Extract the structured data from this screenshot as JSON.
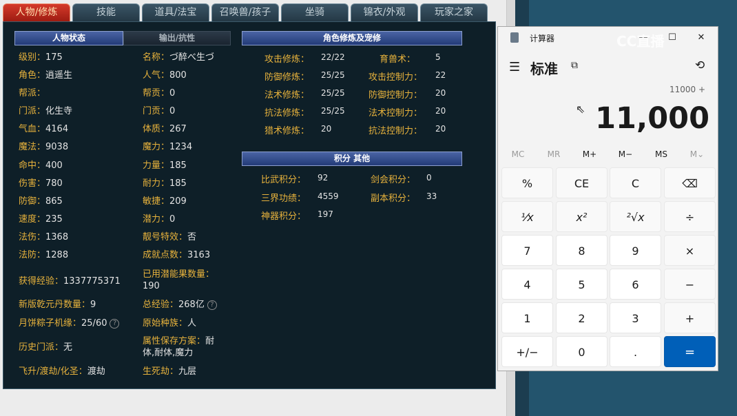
{
  "tabs": [
    "人物/修炼",
    "技能",
    "道具/法宝",
    "召唤兽/孩子",
    "坐骑",
    "锦衣/外观",
    "玩家之家"
  ],
  "headers": {
    "status": "人物状态",
    "output": "输出/抗性",
    "cultivation": "角色修炼及宠修",
    "points": "积分 其他"
  },
  "left_col": [
    {
      "k": "级别：",
      "v": "175"
    },
    {
      "k": "角色：",
      "v": "逍遥生"
    },
    {
      "k": "帮派：",
      "v": ""
    },
    {
      "k": "门派：",
      "v": "化生寺"
    },
    {
      "k": "气血：",
      "v": "4164"
    },
    {
      "k": "魔法：",
      "v": "9038"
    },
    {
      "k": "命中：",
      "v": "400"
    },
    {
      "k": "伤害：",
      "v": "780"
    },
    {
      "k": "防御：",
      "v": "865"
    },
    {
      "k": "速度：",
      "v": "235"
    },
    {
      "k": "法伤：",
      "v": "1368"
    },
    {
      "k": "法防：",
      "v": "1288"
    }
  ],
  "right_col": [
    {
      "k": "名称：",
      "v": "づ醉べ生づ"
    },
    {
      "k": "人气：",
      "v": "800"
    },
    {
      "k": "帮贡：",
      "v": "0"
    },
    {
      "k": "门贡：",
      "v": "0"
    },
    {
      "k": "体质：",
      "v": "267"
    },
    {
      "k": "魔力：",
      "v": "1234"
    },
    {
      "k": "力量：",
      "v": "185"
    },
    {
      "k": "耐力：",
      "v": "185"
    },
    {
      "k": "敏捷：",
      "v": "209"
    },
    {
      "k": "潜力：",
      "v": "0"
    },
    {
      "k": "靓号特效：",
      "v": "否"
    },
    {
      "k": "成就点数：",
      "v": "3163"
    }
  ],
  "extra": {
    "exp_k": "获得经验：",
    "exp_v": "1337775371",
    "potion_k": "已用潜能果数量：",
    "potion_v": "190",
    "qianyuan_k": "新版乾元丹数量：",
    "qianyuan_v": "9",
    "total_exp_k": "总经验：",
    "total_exp_v": "268亿",
    "zongzi_k": "月饼粽子机缘：",
    "zongzi_v": "25/60",
    "race_k": "原始种族：",
    "race_v": "人",
    "history_k": "历史门派：",
    "history_v": "无",
    "attr_k": "属性保存方案：",
    "attr_v1": "耐",
    "attr_v2": "体,耐体,魔力",
    "fly_k": "飞升/渡劫/化圣：",
    "fly_v": "渡劫",
    "life_k": "生死劫：",
    "life_v": "九层"
  },
  "cultivation": [
    {
      "k": "攻击修炼：",
      "v": "22/22",
      "k2": "育兽术：",
      "v2": "5"
    },
    {
      "k": "防御修炼：",
      "v": "25/25",
      "k2": "攻击控制力：",
      "v2": "22"
    },
    {
      "k": "法术修炼：",
      "v": "25/25",
      "k2": "防御控制力：",
      "v2": "20"
    },
    {
      "k": "抗法修炼：",
      "v": "25/25",
      "k2": "法术控制力：",
      "v2": "20"
    },
    {
      "k": "猎术修炼：",
      "v": "20",
      "k2": "抗法控制力：",
      "v2": "20"
    }
  ],
  "points": [
    {
      "k": "比武积分：",
      "v": "92",
      "k2": "剑会积分：",
      "v2": "0"
    },
    {
      "k": "三界功绩：",
      "v": "4559",
      "k2": "副本积分：",
      "v2": "33"
    },
    {
      "k": "神器积分：",
      "v": "197",
      "k2": "",
      "v2": ""
    }
  ],
  "calculator": {
    "title": "计算器",
    "mode": "标准",
    "expression": "11000 +",
    "display": "11,000",
    "memory": [
      "MC",
      "MR",
      "M+",
      "M−",
      "MS",
      "M⌄"
    ],
    "keys": [
      [
        "%",
        "CE",
        "C",
        "⌫"
      ],
      [
        "⅟x",
        "x²",
        "²√x",
        "÷"
      ],
      [
        "7",
        "8",
        "9",
        "×"
      ],
      [
        "4",
        "5",
        "6",
        "−"
      ],
      [
        "1",
        "2",
        "3",
        "+"
      ],
      [
        "+/−",
        "0",
        ".",
        "="
      ]
    ]
  },
  "watermark": "CC直播"
}
